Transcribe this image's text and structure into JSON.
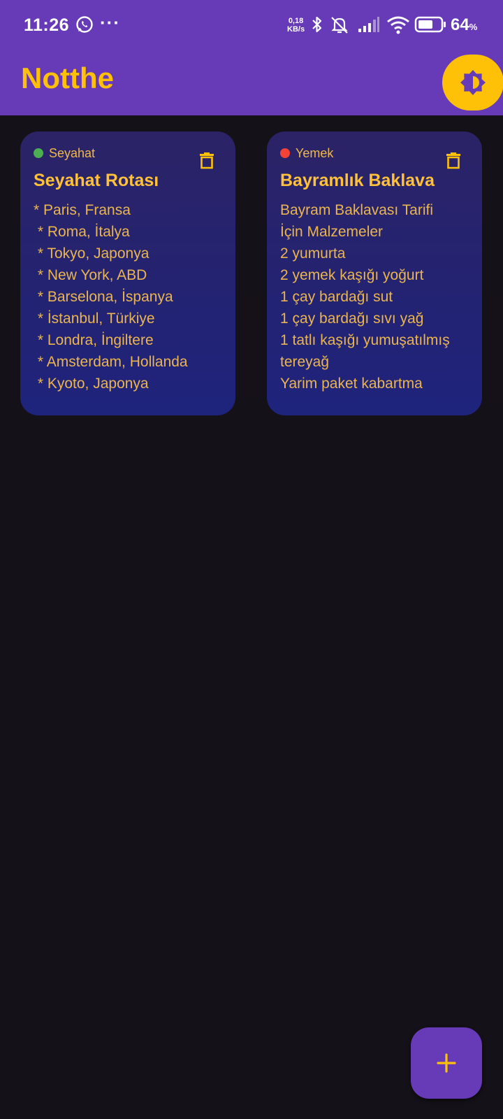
{
  "status_bar": {
    "time": "11:26",
    "net_speed_value": "0,18",
    "net_speed_unit": "KB/s",
    "battery_percent": "64",
    "battery_unit": "%"
  },
  "app": {
    "title": "Notthe",
    "accent_color": "#ffc107",
    "bar_color": "#673ab7"
  },
  "notes": [
    {
      "category": "Seyahat",
      "category_color": "#4caf50",
      "title": "Seyahat Rotası",
      "body": "* Paris, Fransa\n * Roma, İtalya\n * Tokyo, Japonya\n * New York, ABD\n * Barselona, İspanya\n * İstanbul, Türkiye\n * Londra, İngiltere\n * Amsterdam, Hollanda\n * Kyoto, Japonya"
    },
    {
      "category": "Yemek",
      "category_color": "#f44336",
      "title": "Bayramlık Baklava",
      "body": "Bayram Baklavası Tarifi\nİçin Malzemeler\n2 yumurta\n2 yemek kaşığı yoğurt\n1 çay bardağı sut\n1 çay bardağı sıvı yağ\n1 tatlı kaşığı yumuşatılmış tereyağ\nYarim paket kabartma"
    }
  ],
  "icons": {
    "theme_toggle": "brightness-icon",
    "delete": "trash-icon",
    "add": "plus-icon"
  }
}
